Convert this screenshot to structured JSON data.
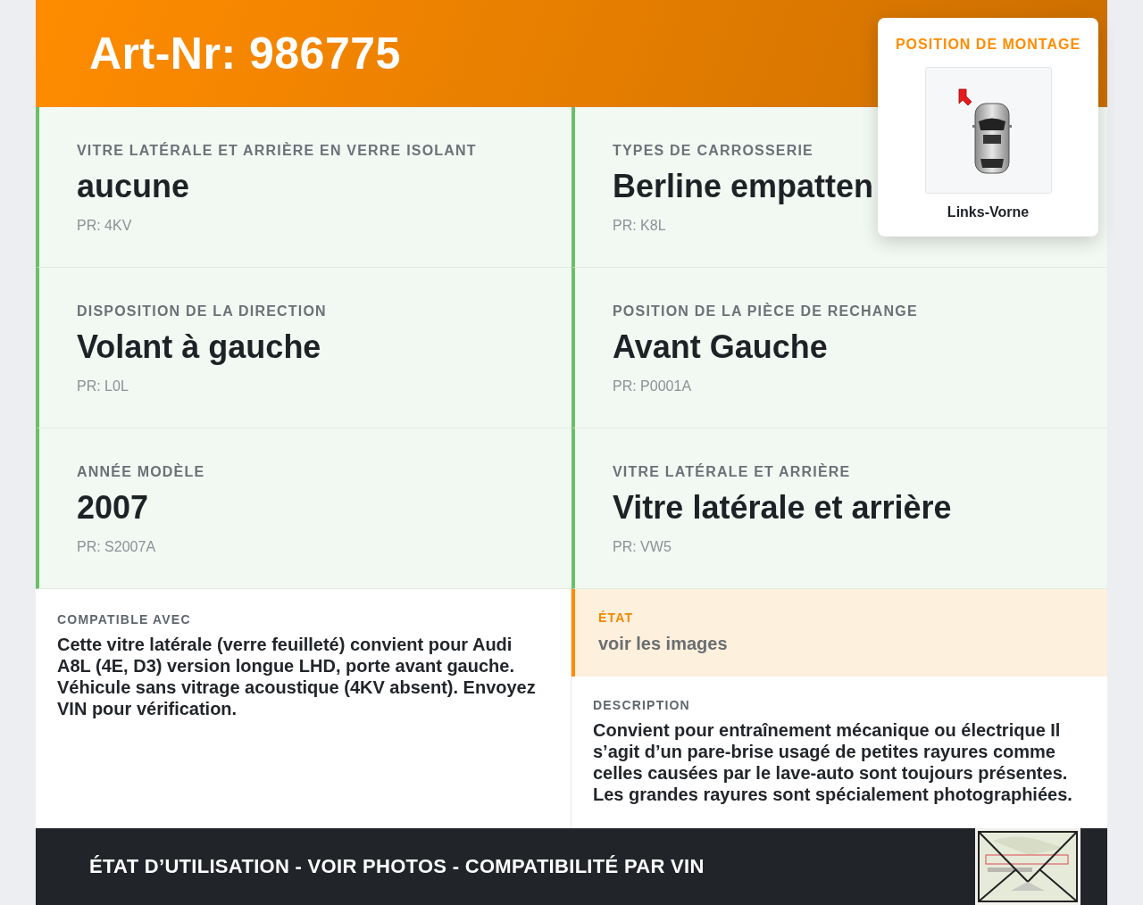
{
  "header": {
    "title": "Art-Nr: 986775"
  },
  "mounting": {
    "title": "POSITION DE MONTAGE",
    "position": "Links-Vorne"
  },
  "specs": [
    {
      "label": "VITRE LATÉRALE ET ARRIÈRE EN VERRE ISOLANT",
      "value": "aucune",
      "code": "PR: 4KV"
    },
    {
      "label": "TYPES DE CARROSSERIE",
      "value": "Berline empatten",
      "code": "PR: K8L"
    },
    {
      "label": "DISPOSITION DE LA DIRECTION",
      "value": "Volant à gauche",
      "code": "PR: L0L"
    },
    {
      "label": "POSITION DE LA PIÈCE DE RECHANGE",
      "value": "Avant Gauche",
      "code": "PR: P0001A"
    },
    {
      "label": "ANNÉE MODÈLE",
      "value": "2007",
      "code": "PR: S2007A"
    },
    {
      "label": "VITRE LATÉRALE ET ARRIÈRE",
      "value": "Vitre latérale et arrière",
      "code": "PR: VW5"
    }
  ],
  "compatible": {
    "label": "COMPATIBLE AVEC",
    "text": "Cette vitre latérale (verre feuilleté) convient pour Audi A8L (4E, D3) version longue LHD, porte avant gauche. Véhicule sans vitrage acoustique (4KV absent). Envoyez VIN pour vérification."
  },
  "condition": {
    "label": "ÉTAT",
    "text": "voir les images"
  },
  "description": {
    "label": "DESCRIPTION",
    "text": "Convient pour entraînement mécanique ou électrique Il s’agit d’un pare-brise usagé de petites rayures comme celles causées par le lave-auto sont toujours présentes. Les grandes rayures sont spécialement photographiées."
  },
  "footer": {
    "text": "ÉTAT D’UTILISATION - VOIR PHOTOS - COMPATIBILITÉ PAR VIN"
  }
}
